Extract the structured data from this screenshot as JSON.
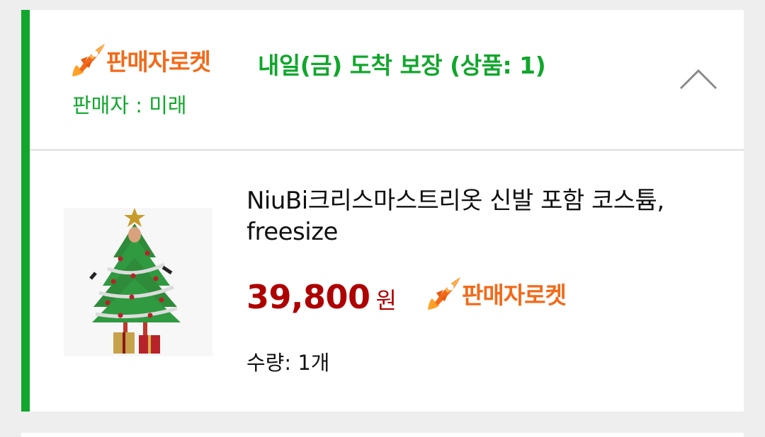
{
  "colors": {
    "accent_green": "#11a72c",
    "rocket_orange": "#f26a19",
    "price_red": "#ae0000"
  },
  "shipment": {
    "badge_label": "판매자로켓",
    "badge_icon": "rocket-icon",
    "delivery_text": "내일(금) 도착 보장 (상품: 1)",
    "seller_text": "판매자 : 미래",
    "collapse_icon": "chevron-up-icon"
  },
  "product": {
    "name": "NiuBi크리스마스트리옷 신발 포함 코스튬, freesize",
    "price_value": "39,800",
    "price_unit": "원",
    "badge_label": "판매자로켓",
    "badge_icon": "rocket-icon",
    "quantity_text": "수량: 1개",
    "thumbnail_icon": "christmas-tree-costume-image"
  }
}
